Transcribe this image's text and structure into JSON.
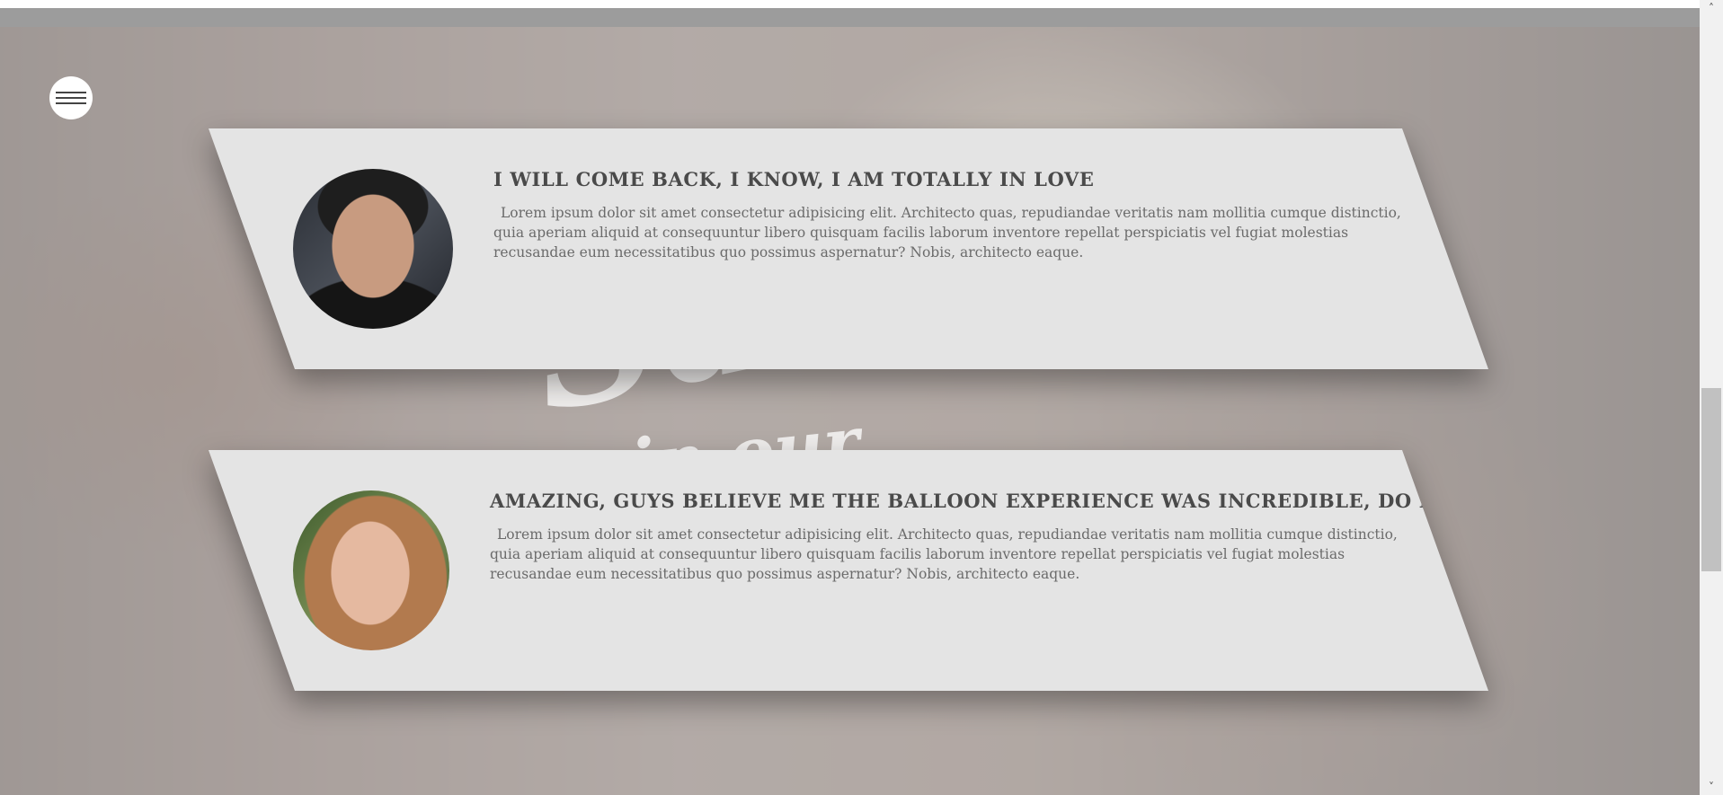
{
  "hero": {
    "logo_line1": "Salt",
    "logo_line2": "in our"
  },
  "testimonials": [
    {
      "title": "I WILL COME BACK, I KNOW, I AM TOTALLY IN LOVE",
      "text": "Lorem ipsum dolor sit amet consectetur adipisicing elit. Architecto quas, repudiandae veritatis nam mollitia cumque distinctio, quia aperiam aliquid at consequuntur libero quisquam facilis laborum inventore repellat perspiciatis vel fugiat molestias recusandae eum necessitatibus quo possimus aspernatur? Nobis, architecto eaque."
    },
    {
      "title": "AMAZING, GUYS BELIEVE ME THE BALLOON EXPERIENCE WAS INCREDIBLE, DO IT!",
      "text": "Lorem ipsum dolor sit amet consectetur adipisicing elit. Architecto quas, repudiandae veritatis nam mollitia cumque distinctio, quia aperiam aliquid at consequuntur libero quisquam facilis laborum inventore repellat perspiciatis vel fugiat molestias recusandae eum necessitatibus quo possimus aspernatur? Nobis, architecto eaque."
    }
  ],
  "icons": {
    "menu": "hamburger-icon",
    "scroll_up": "chevron-up-icon",
    "scroll_down": "chevron-down-icon"
  },
  "colors": {
    "card_background": "#e4e4e4",
    "title_text": "#4a4a4a",
    "body_text": "#6b6b6b",
    "top_strip": "#9c9c9c"
  }
}
